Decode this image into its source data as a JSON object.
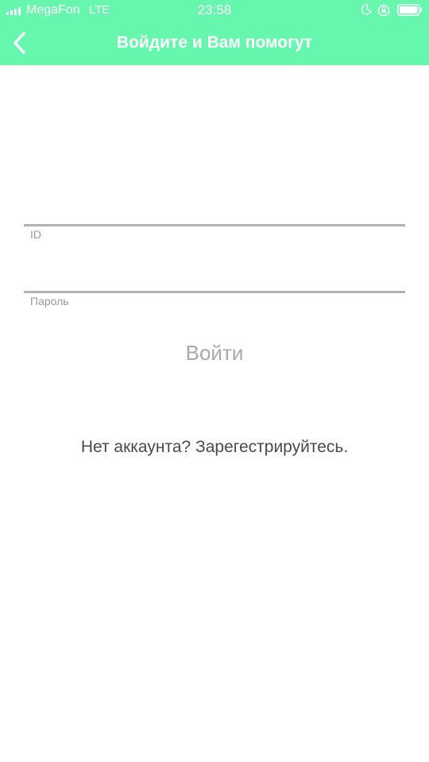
{
  "status_bar": {
    "carrier": "MegaFon",
    "network": "LTE",
    "time": "23:58"
  },
  "header": {
    "title": "Войдите и Вам помогут",
    "back_icon": "chevron-left-icon"
  },
  "form": {
    "id_label": "ID",
    "password_label": "Пароль",
    "id_value": "",
    "password_value": ""
  },
  "actions": {
    "login_label": "Войти",
    "register_text": "Нет аккаунта? Зарегестрируйтесь."
  },
  "colors": {
    "header_bg": "#66f6ad",
    "header_text": "#ffffff",
    "field_line": "#b2b2b2",
    "label": "#9a9a9a",
    "login_text": "#a9a9a9",
    "register_text": "#4a4a4a"
  }
}
